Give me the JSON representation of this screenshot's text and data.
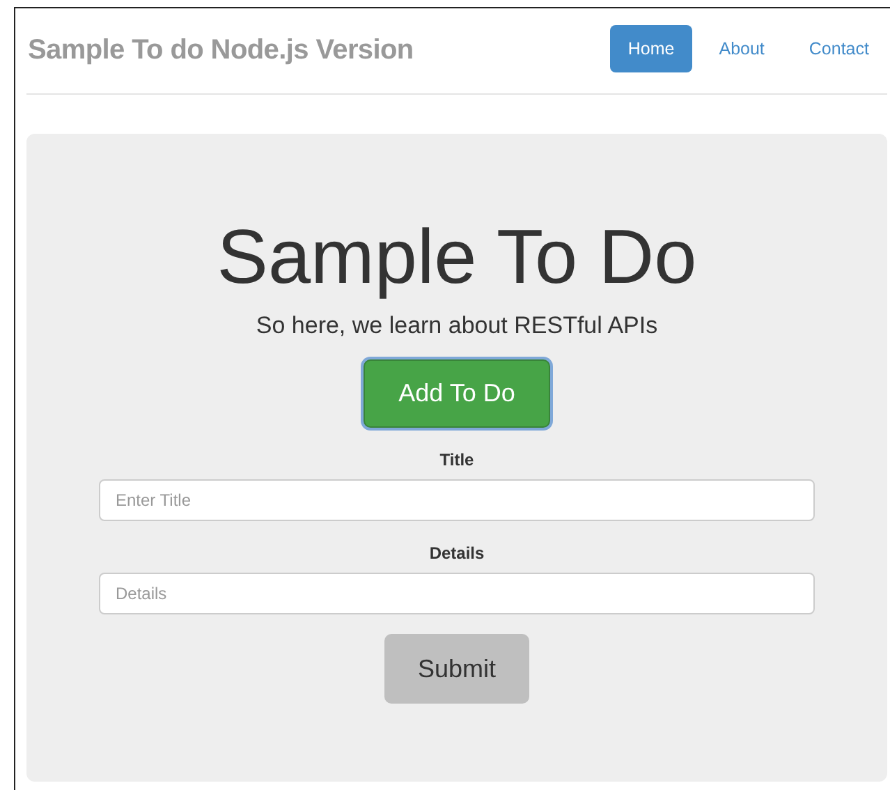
{
  "navbar": {
    "brand": "Sample To do Node.js Version",
    "links": [
      {
        "label": "Home",
        "selected": true
      },
      {
        "label": "About",
        "selected": false
      },
      {
        "label": "Contact",
        "selected": false
      }
    ]
  },
  "hero": {
    "heading": "Sample To Do",
    "subtitle": "So here, we learn about RESTful APIs",
    "add_button": {
      "label": "Add To Do",
      "focused": true
    }
  },
  "form": {
    "fields": [
      {
        "label": "Title",
        "placeholder": "Enter Title"
      },
      {
        "label": "Details",
        "placeholder": "Details"
      }
    ],
    "submit": "Submit"
  }
}
